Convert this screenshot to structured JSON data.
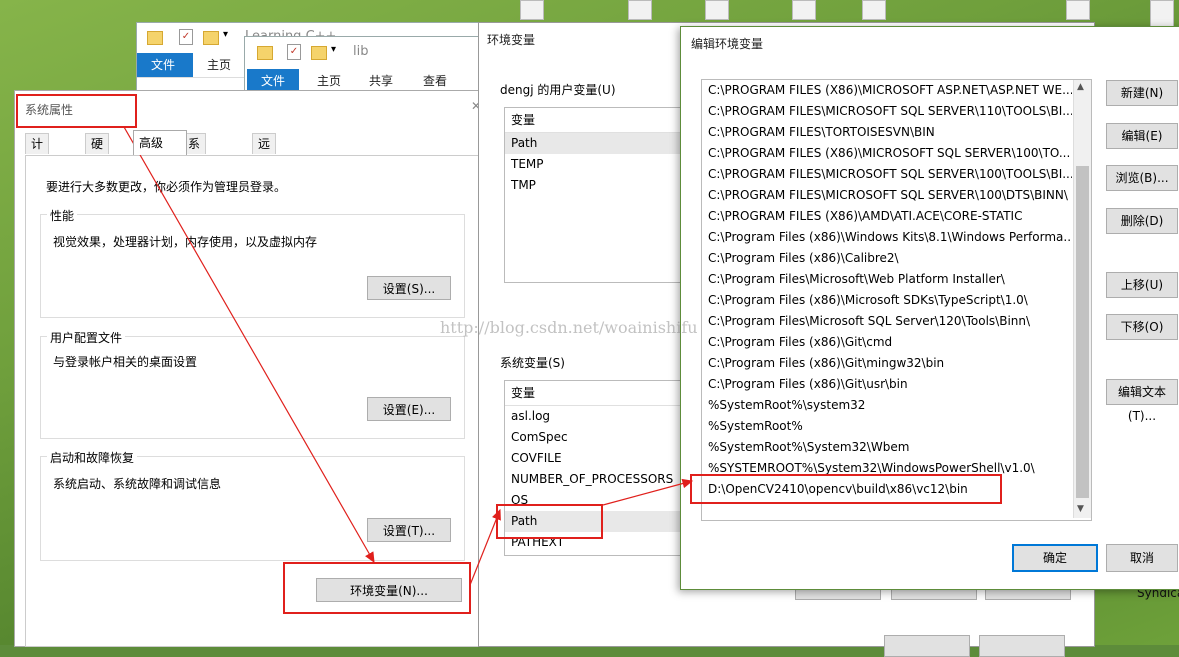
{
  "desktop": {
    "right_label": "Syndica"
  },
  "explorer_back": {
    "crumb": "Learning C++",
    "tabs": [
      "文件",
      "主页"
    ]
  },
  "explorer_front": {
    "crumb": "lib",
    "tabs": [
      "文件",
      "主页",
      "共享",
      "查看"
    ]
  },
  "system_properties": {
    "title": "系统属性",
    "tabs": [
      "计算机名",
      "硬件",
      "高级",
      "系统保护",
      "远程"
    ],
    "active_tab": "高级",
    "admin_note": "要进行大多数更改，你必须作为管理员登录。",
    "performance": {
      "label": "性能",
      "desc": "视觉效果，处理器计划，内存使用，以及虚拟内存",
      "button": "设置(S)..."
    },
    "profiles": {
      "label": "用户配置文件",
      "desc": "与登录帐户相关的桌面设置",
      "button": "设置(E)..."
    },
    "startup": {
      "label": "启动和故障恢复",
      "desc": "系统启动、系统故障和调试信息",
      "button": "设置(T)..."
    },
    "env_button": "环境变量(N)..."
  },
  "env_vars": {
    "title": "环境变量",
    "user_label": "dengj 的用户变量(U)",
    "column": "变量",
    "user_vars": [
      "Path",
      "TEMP",
      "TMP"
    ],
    "system_label": "系统变量(S)",
    "system_vars": [
      "asl.log",
      "ComSpec",
      "COVFILE",
      "NUMBER_OF_PROCESSORS",
      "OS",
      "Path",
      "PATHEXT"
    ]
  },
  "edit_env": {
    "title": "编辑环境变量",
    "paths": [
      "C:\\PROGRAM FILES (X86)\\MICROSOFT ASP.NET\\ASP.NET WE...",
      "C:\\PROGRAM FILES\\MICROSOFT SQL SERVER\\110\\TOOLS\\BI...",
      "C:\\PROGRAM FILES\\TORTOISESVN\\BIN",
      "C:\\PROGRAM FILES (X86)\\MICROSOFT SQL SERVER\\100\\TO...",
      "C:\\PROGRAM FILES\\MICROSOFT SQL SERVER\\100\\TOOLS\\BI...",
      "C:\\PROGRAM FILES\\MICROSOFT SQL SERVER\\100\\DTS\\BINN\\",
      "C:\\PROGRAM FILES (X86)\\AMD\\ATI.ACE\\CORE-STATIC",
      "C:\\Program Files (x86)\\Windows Kits\\8.1\\Windows Performa...",
      "C:\\Program Files (x86)\\Calibre2\\",
      "C:\\Program Files\\Microsoft\\Web Platform Installer\\",
      "C:\\Program Files (x86)\\Microsoft SDKs\\TypeScript\\1.0\\",
      "C:\\Program Files\\Microsoft SQL Server\\120\\Tools\\Binn\\",
      "C:\\Program Files (x86)\\Git\\cmd",
      "C:\\Program Files (x86)\\Git\\mingw32\\bin",
      "C:\\Program Files (x86)\\Git\\usr\\bin",
      "%SystemRoot%\\system32",
      "%SystemRoot%",
      "%SystemRoot%\\System32\\Wbem",
      "%SYSTEMROOT%\\System32\\WindowsPowerShell\\v1.0\\",
      "D:\\OpenCV2410\\opencv\\build\\x86\\vc12\\bin"
    ],
    "buttons": [
      "新建(N)",
      "编辑(E)",
      "浏览(B)...",
      "删除(D)",
      "上移(U)",
      "下移(O)",
      "编辑文本(T)..."
    ],
    "ok": "确定",
    "cancel": "取消"
  },
  "watermark": "http://blog.csdn.net/woainishifu",
  "colors": {
    "annotation": "#e0201c",
    "accent": "#0078d7",
    "file_tab": "#1979ca"
  }
}
